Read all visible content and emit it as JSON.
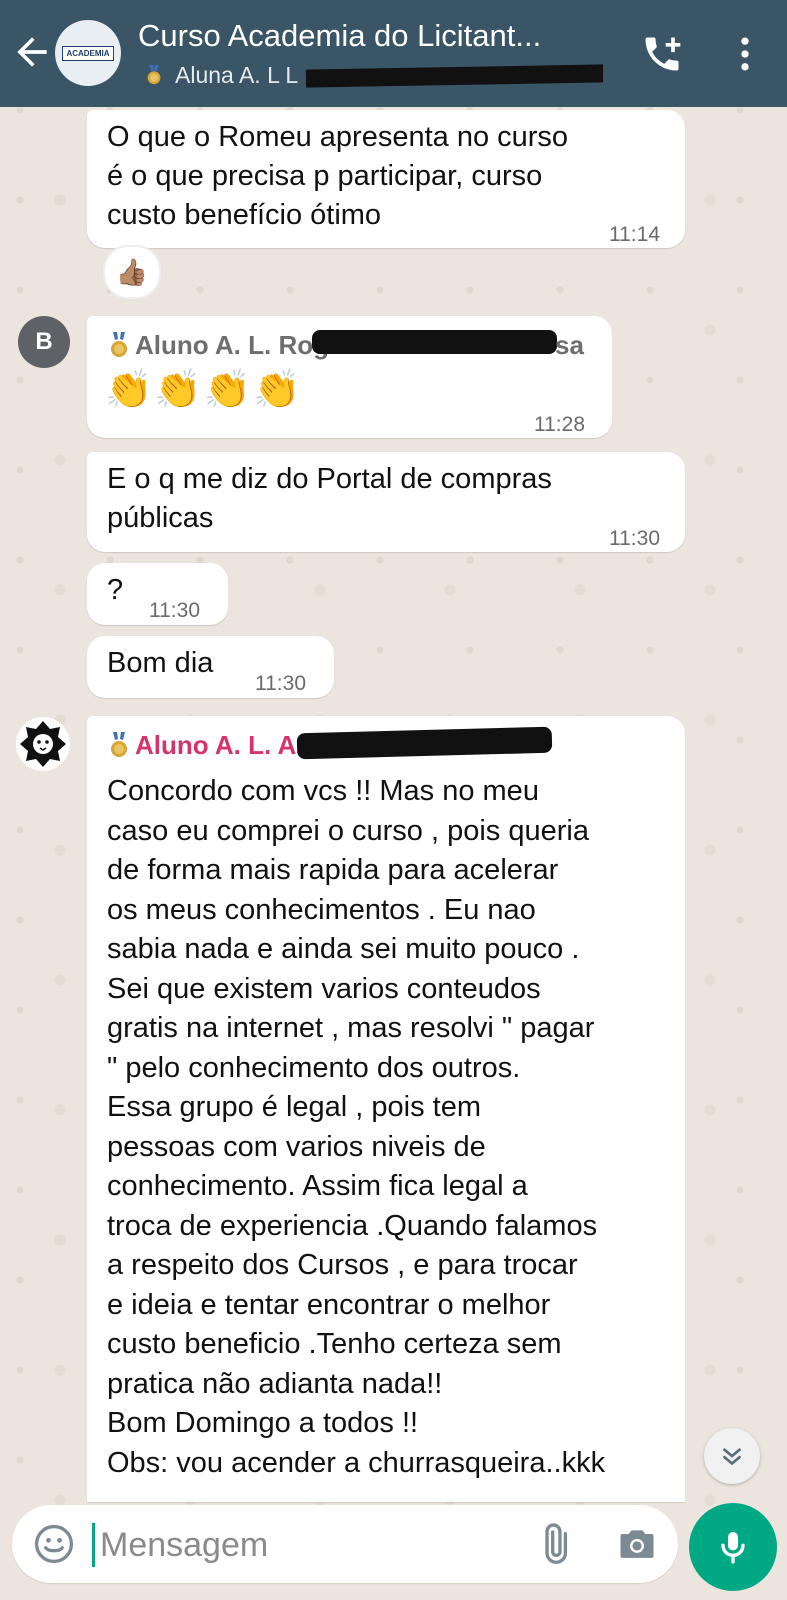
{
  "header": {
    "title": "Curso Academia do Licitant...",
    "subtitle_visible": "Aluna A. L L",
    "subtitle_tail": "...",
    "avatar_logo_text": "ACADEMIA",
    "colors": {
      "bar": "#3A5566"
    }
  },
  "messages": [
    {
      "text_lines": [
        "O que o Romeu apresenta no curso",
        "é o que precisa p participar, curso",
        "custo benefício ótimo"
      ],
      "time": "11:14",
      "reaction": "👍🏽"
    },
    {
      "avatar_letter": "B",
      "sender_prefix": "Aluno A. L. Rog",
      "sender_suffix": "sa",
      "sender_color": "#6E6E6E",
      "emoji": "👏👏👏👏",
      "time": "11:28"
    },
    {
      "text_lines": [
        "E o q me diz do Portal de compras",
        "públicas"
      ],
      "time": "11:30"
    },
    {
      "text": "?",
      "time": "11:30"
    },
    {
      "text": "Bom dia",
      "time": "11:30"
    },
    {
      "sender_prefix": "Aluno A. L. A",
      "sender_color": "#D6336C",
      "text_lines": [
        "Concordo com vcs !! Mas no meu",
        "caso eu comprei o curso , pois queria",
        "de  forma mais rapida para acelerar",
        "os meus conhecimentos . Eu nao",
        "sabia nada e ainda sei muito pouco .",
        "Sei que existem varios conteudos",
        "gratis na internet , mas resolvi \" pagar",
        "\" pelo conhecimento dos outros.",
        "Essa grupo é legal , pois tem",
        "pessoas com varios niveis de",
        "conhecimento. Assim fica legal a",
        "troca de experiencia .Quando falamos",
        "a respeito dos Cursos  , e para trocar",
        "e ideia e tentar encontrar o melhor",
        "custo beneficio .Tenho certeza sem",
        "pratica  não adianta nada!!",
        "Bom Domingo a todos !!",
        "Obs: vou acender a churrasqueira..kkk"
      ]
    }
  ],
  "composer": {
    "placeholder": "Mensagem"
  },
  "icons": [
    "back-arrow-icon",
    "call-add-icon",
    "more-vert-icon",
    "emoji-icon",
    "attach-icon",
    "camera-icon",
    "mic-icon",
    "chevron-down-icon",
    "medal-icon"
  ],
  "colors": {
    "accent": "#00A884",
    "chat_bg": "#ECE5DD"
  }
}
